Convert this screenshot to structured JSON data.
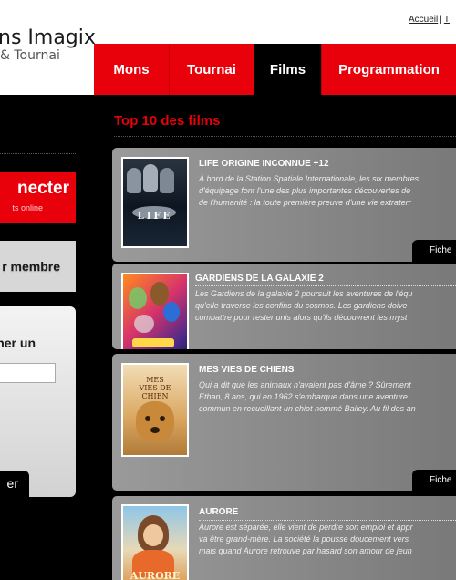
{
  "header": {
    "brand_main": "ns Imagix",
    "brand_sub": "& Tournai",
    "links": [
      "Accueil",
      "T"
    ],
    "link_separator": "|"
  },
  "nav": {
    "items": [
      "Mons",
      "Tournai",
      "Films",
      "Programmation"
    ],
    "active": "Films"
  },
  "sidebar": {
    "connect_title": "necter",
    "connect_sub": "ts online",
    "member_text": "r membre",
    "login_text": "ner un",
    "login_button": "er"
  },
  "main": {
    "section_title": "Top 10 des films",
    "fiche_label": "Fiche",
    "films": [
      {
        "title": "LIFE ORIGINE INCONNUE +12",
        "poster_caption": "LIFE",
        "synopsis": [
          "À bord de la Station Spatiale Internationale, les six membres",
          "d'équipage font l'une des plus importantes découvertes de",
          "de l'humanité : la toute première preuve d'une vie extraterr"
        ]
      },
      {
        "title": "GARDIENS DE LA GALAXIE 2",
        "poster_caption": "",
        "synopsis": [
          "Les Gardiens de la galaxie 2 poursuit les aventures de l'équ",
          "qu'elle traverse les confins du cosmos. Les gardiens doive",
          "combattre pour rester unis alors qu'ils découvrent les myst"
        ]
      },
      {
        "title": "MES VIES DE CHIENS",
        "poster_caption": "MES VIES DE CHIEN",
        "synopsis": [
          "Qui a dit que les animaux n'avaient pas d'âme ? Sûrement",
          "Ethan, 8 ans, qui en 1962 s'embarque dans une aventure",
          "commun en recueillant un chiot nommé Bailey. Au fil des an"
        ]
      },
      {
        "title": "AURORE",
        "poster_caption": "AURORE",
        "synopsis": [
          "Aurore est séparée, elle vient de perdre son emploi et appr",
          "va être grand-mère. La société la pousse doucement vers",
          "mais quand Aurore retrouve par hasard son amour de jeun"
        ]
      }
    ]
  },
  "colors": {
    "accent_red": "#e8000b",
    "background": "#000000",
    "card_gray": "#8a8a8a"
  }
}
